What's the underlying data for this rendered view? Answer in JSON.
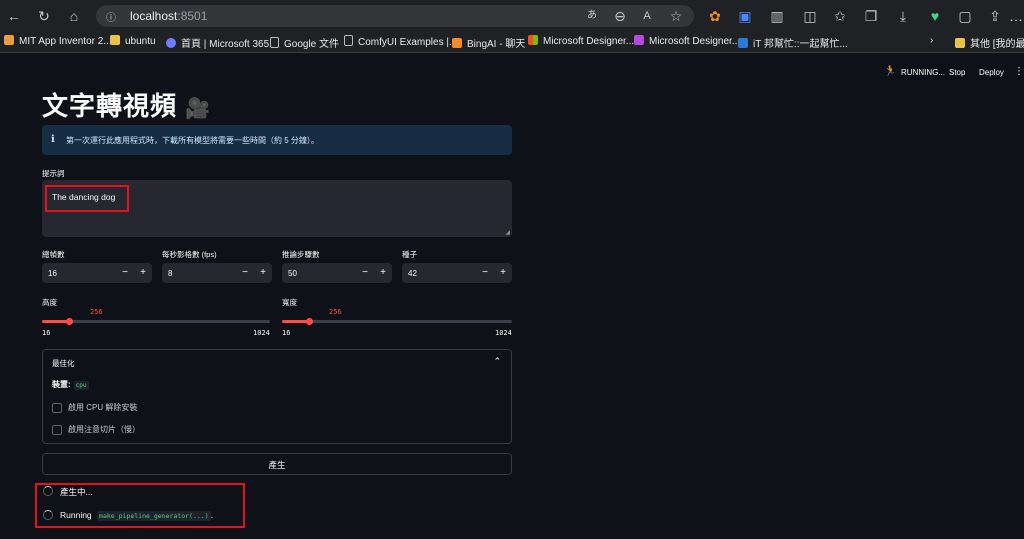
{
  "browser": {
    "url_host": "localhost",
    "url_port": ":8501",
    "bookmarks": [
      "MIT App Inventor 2...",
      "ubuntu",
      "首頁 | Microsoft 365",
      "Google 文件",
      "ComfyUI Examples |...",
      "BingAI - 聊天",
      "Microsoft Designer...",
      "Microsoft Designer...",
      "iT 邦幫忙::一起幫忙...",
      "其他 [我的最愛]"
    ]
  },
  "header": {
    "status": "RUNNING...",
    "stop_label": "Stop",
    "deploy_label": "Deploy"
  },
  "title": "文字轉視頻",
  "title_icon": "🎥",
  "info": {
    "text": "第一次運行此應用程式時，下載所有模型將需要一些時間（約 5 分鐘）。"
  },
  "prompt": {
    "label": "提示詞",
    "value": "The dancing dog"
  },
  "numbers": [
    {
      "label": "總幀數",
      "value": "16"
    },
    {
      "label": "每秒影格數 (fps)",
      "value": "8"
    },
    {
      "label": "推論步驟數",
      "value": "50"
    },
    {
      "label": "種子",
      "value": "42"
    }
  ],
  "sliders": [
    {
      "label": "高度",
      "value": "256",
      "min": "16",
      "max": "1024",
      "fraction": 0.1176
    },
    {
      "label": "寬度",
      "value": "256",
      "min": "16",
      "max": "1024",
      "fraction": 0.1176
    }
  ],
  "expander": {
    "title": "最佳化",
    "device_label": "裝置:",
    "device_value": "cpu",
    "checkboxes": [
      "啟用 CPU 解除安裝",
      "啟用注意切片（慢）"
    ]
  },
  "generate_button": "產生",
  "status_lines": {
    "generating": "產生中...",
    "running_prefix": "Running",
    "running_code": "make_pipeline_generator(...)",
    "running_suffix": "."
  },
  "colors": {
    "accent": "#ff4b4b",
    "highlight": "#e3121b",
    "info_bg": "#172d43"
  }
}
